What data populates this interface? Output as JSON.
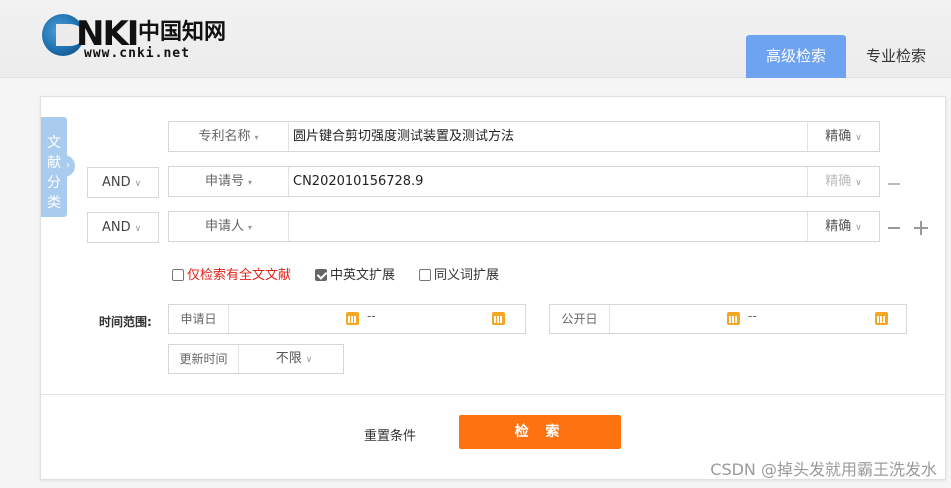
{
  "brand": {
    "logo_letters": "CNKI",
    "logo_cn": "中国知网",
    "logo_url": "www.cnki.net"
  },
  "tabs": {
    "advanced": "高级检索",
    "professional": "专业检索"
  },
  "category_tab": [
    "文",
    "献",
    "分",
    "类"
  ],
  "rows": [
    {
      "logic": "",
      "field": "专利名称",
      "value": "圆片键合剪切强度测试装置及测试方法",
      "precision": "精确",
      "precision_disabled": false
    },
    {
      "logic": "AND",
      "field": "申请号",
      "value": "CN202010156728.9",
      "precision": "精确",
      "precision_disabled": true
    },
    {
      "logic": "AND",
      "field": "申请人",
      "value": "",
      "precision": "精确",
      "precision_disabled": false
    }
  ],
  "options": [
    {
      "label": "仅检索有全文文献",
      "checked": false
    },
    {
      "label": "中英文扩展",
      "checked": true
    },
    {
      "label": "同义词扩展",
      "checked": false
    }
  ],
  "time_range": {
    "label": "时间范围:",
    "apply_date": "申请日",
    "publish_date": "公开日",
    "separator": "--",
    "update_time": "更新时间",
    "update_value": "不限"
  },
  "actions": {
    "reset": "重置条件",
    "search": "检 索"
  },
  "watermark": "CSDN @掉头发就用霸王洗发水",
  "colors": {
    "tab_active": "#6ea3f2",
    "search_button": "#ff7212",
    "category_tab": "#a9cbed",
    "highlight_text": "#e2231a"
  }
}
